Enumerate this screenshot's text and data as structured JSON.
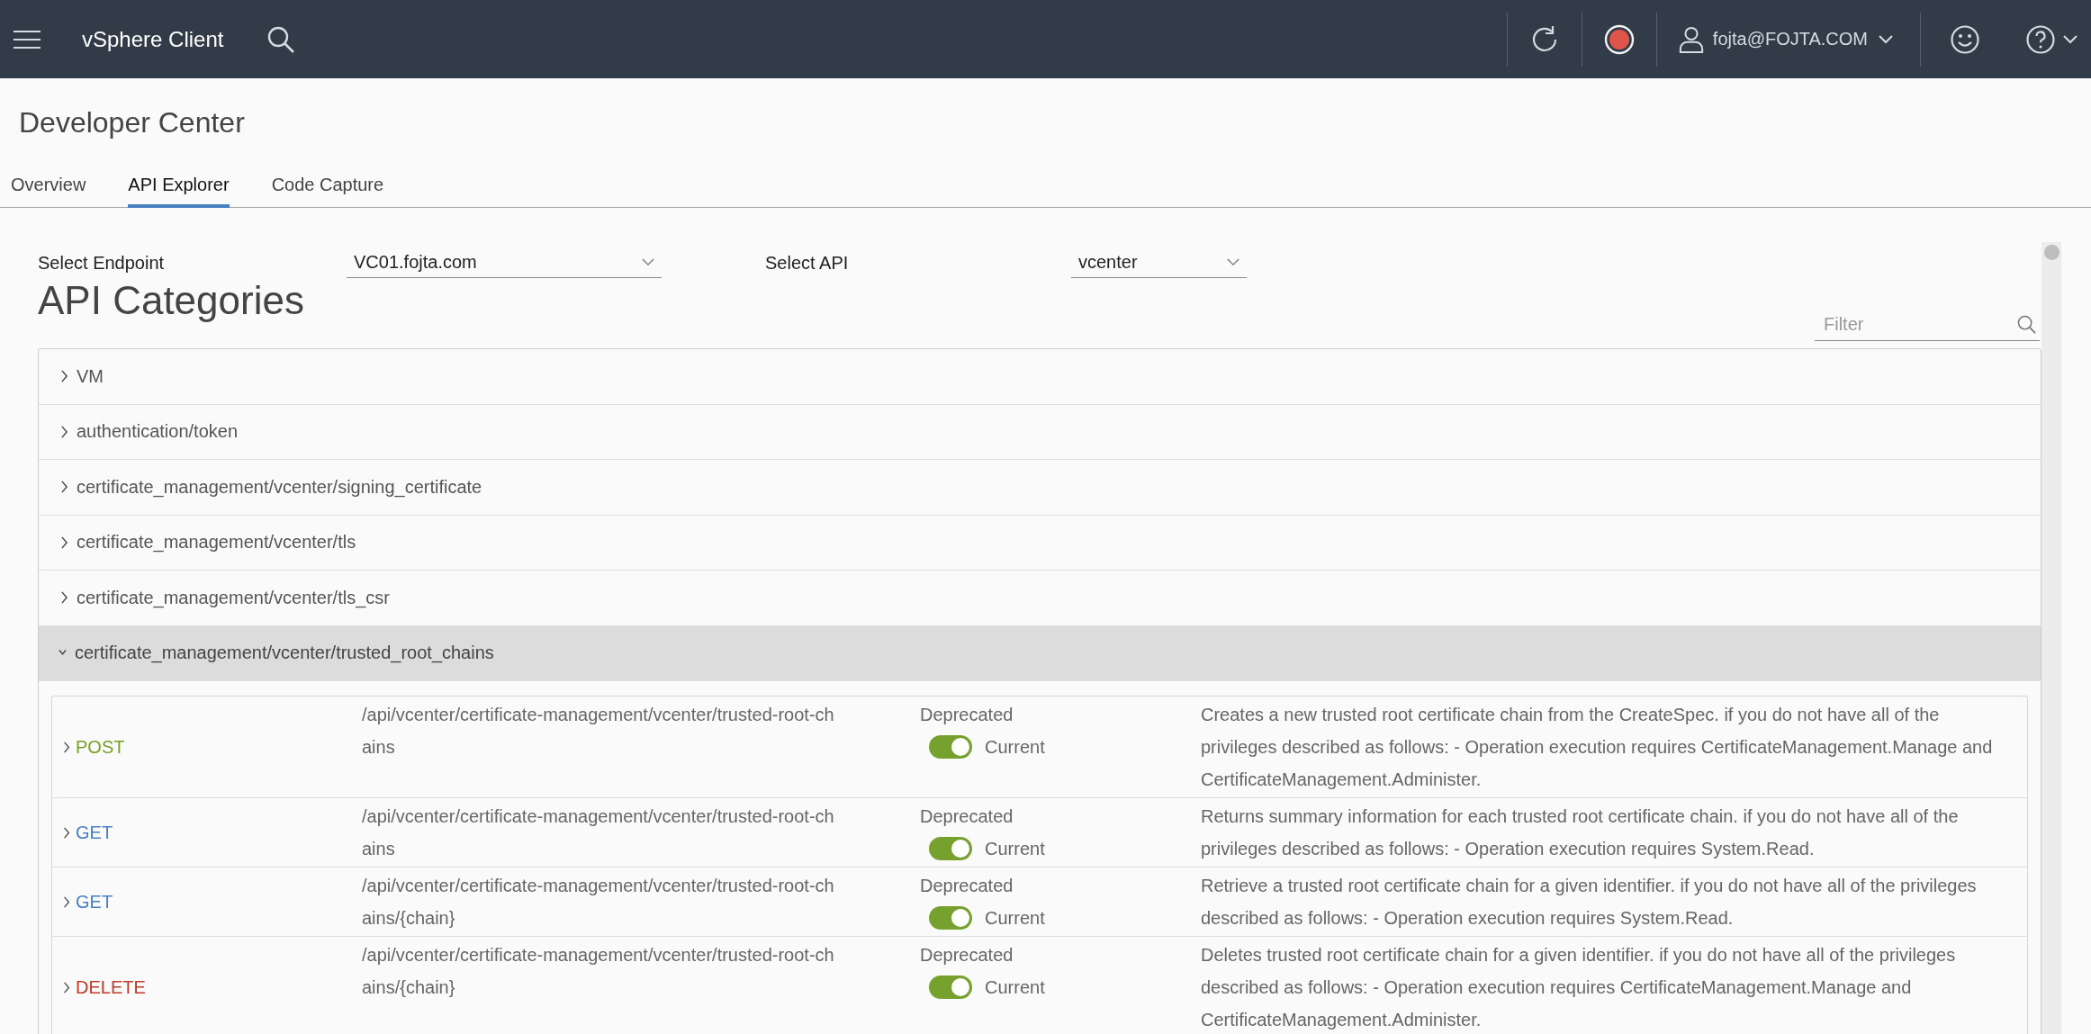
{
  "header": {
    "app_title": "vSphere Client",
    "user": "fojta@FOJTA.COM"
  },
  "page_title": "Developer Center",
  "tabs": [
    {
      "label": "Overview",
      "selected": false
    },
    {
      "label": "API Explorer",
      "selected": true
    },
    {
      "label": "Code Capture",
      "selected": false
    }
  ],
  "selectors": [
    {
      "label": "Select Endpoint",
      "value": "VC01.fojta.com"
    },
    {
      "label": "Select API",
      "value": "vcenter"
    }
  ],
  "section_title": "API Categories",
  "filter": {
    "placeholder": "Filter"
  },
  "categories": [
    {
      "name": "VM",
      "expanded": false
    },
    {
      "name": "authentication/token",
      "expanded": false
    },
    {
      "name": "certificate_management/vcenter/signing_certificate",
      "expanded": false
    },
    {
      "name": "certificate_management/vcenter/tls",
      "expanded": false
    },
    {
      "name": "certificate_management/vcenter/tls_csr",
      "expanded": false
    },
    {
      "name": "certificate_management/vcenter/trusted_root_chains",
      "expanded": true
    }
  ],
  "operations": [
    {
      "method": "POST",
      "color": "#7ba02a",
      "path": "/api/vcenter/certificate-management/vcenter/trusted-root-chains",
      "off_label": "Deprecated",
      "on_label": "Current",
      "on": true,
      "description": "Creates a new trusted root certificate chain from the CreateSpec. if you do not have all of the privileges described as follows: - Operation execution requires CertificateManagement.Manage and CertificateManagement.Administer."
    },
    {
      "method": "GET",
      "color": "#4a7fc1",
      "path": "/api/vcenter/certificate-management/vcenter/trusted-root-chains",
      "off_label": "Deprecated",
      "on_label": "Current",
      "on": true,
      "description": "Returns summary information for each trusted root certificate chain. if you do not have all of the privileges described as follows: - Operation execution requires System.Read."
    },
    {
      "method": "GET",
      "color": "#4a7fc1",
      "path": "/api/vcenter/certificate-management/vcenter/trusted-root-chains/{chain}",
      "off_label": "Deprecated",
      "on_label": "Current",
      "on": true,
      "description": "Retrieve a trusted root certificate chain for a given identifier. if you do not have all of the privileges described as follows: - Operation execution requires System.Read."
    },
    {
      "method": "DELETE",
      "color": "#c0392b",
      "path": "/api/vcenter/certificate-management/vcenter/trusted-root-chains/{chain}",
      "off_label": "Deprecated",
      "on_label": "Current",
      "on": true,
      "description": "Deletes trusted root certificate chain for a given identifier. if you do not have all of the privileges described as follows: - Operation execution requires CertificateManagement.Manage and CertificateManagement.Administer."
    }
  ]
}
